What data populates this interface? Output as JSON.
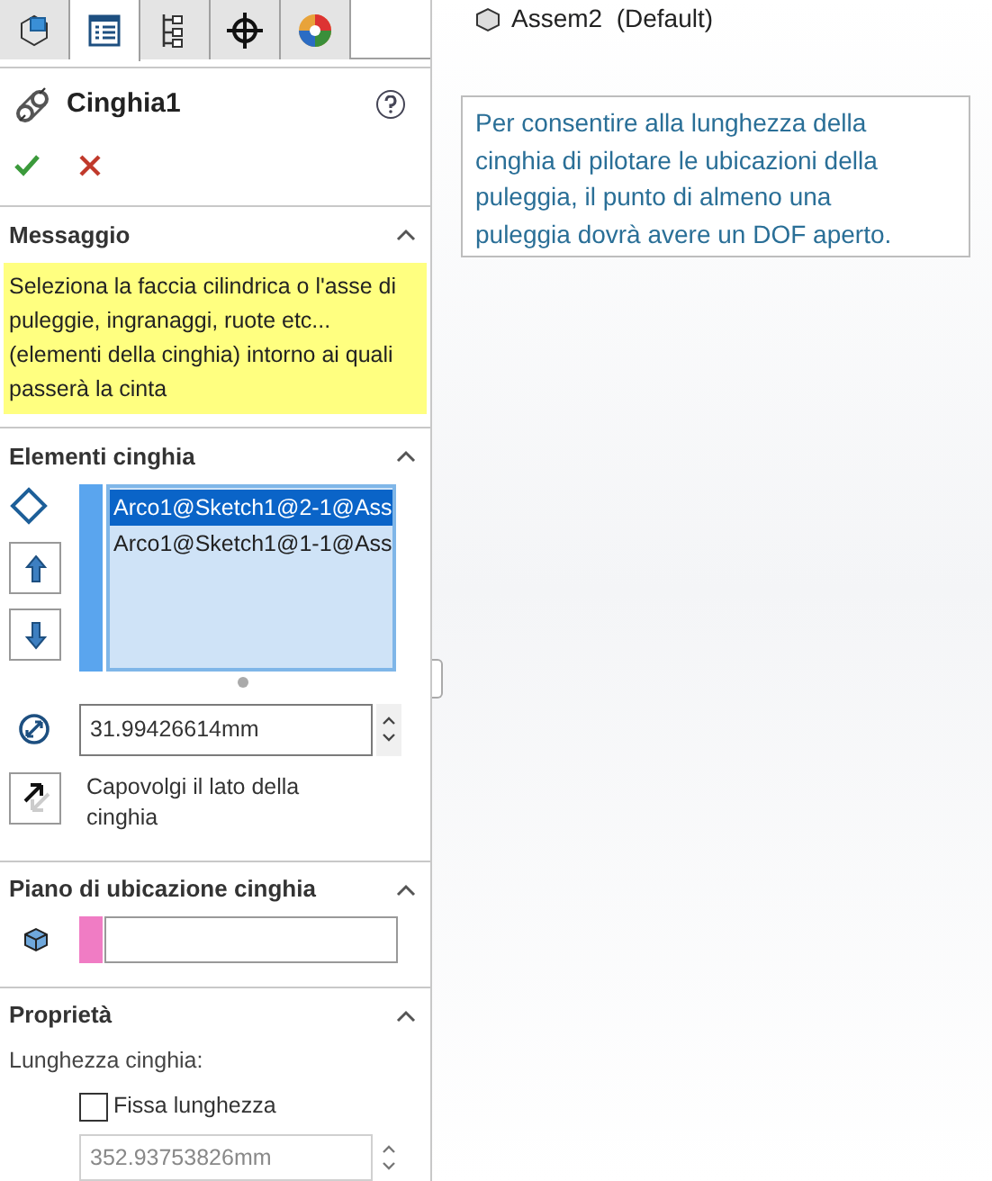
{
  "tabs": [
    {
      "kind": "part",
      "selected": false
    },
    {
      "kind": "properties",
      "selected": true
    },
    {
      "kind": "config",
      "selected": false
    },
    {
      "kind": "target",
      "selected": false
    },
    {
      "kind": "appearance",
      "selected": false
    }
  ],
  "feature": {
    "title": "Cinghia1"
  },
  "tree_item": {
    "label": "Assem2  (Default)"
  },
  "sections": [
    {
      "kind": "message",
      "title": "Messaggio",
      "text": "Seleziona la faccia cilindrica o l'asse di puleggie, ingranaggi, ruote etc... (elementi della cinghia) intorno ai quali passerà la cinta"
    },
    {
      "kind": "members",
      "title": "Elementi cinghia",
      "items": [
        {
          "label": "Arco1@Sketch1@2-1@Ass",
          "selected": true
        },
        {
          "label": "Arco1@Sketch1@1-1@Ass",
          "selected": false
        }
      ],
      "value": "31.99426614mm",
      "flip_label": "Capovolgi il lato della cinghia"
    },
    {
      "kind": "plane",
      "title": "Piano di ubicazione cinghia"
    },
    {
      "kind": "properties",
      "title": "Proprietà",
      "label": "Lunghezza cinghia:",
      "checkbox": {
        "label": "Fissa lunghezza",
        "checked": false
      },
      "length": {
        "value": "352.93753826mm",
        "disabled": true
      }
    }
  ],
  "tooltip": {
    "text": "Per consentire alla lunghezza della cinghia di pilotare le ubicazioni della puleggia, il punto di almeno una puleggia dovrà avere un DOF aperto."
  }
}
